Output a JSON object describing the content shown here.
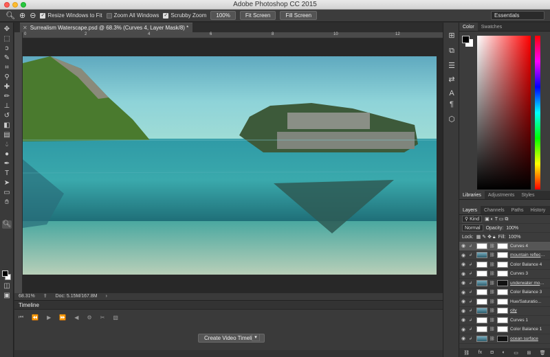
{
  "app": {
    "title": "Adobe Photoshop CC 2015"
  },
  "options": {
    "resize_windows": "Resize Windows to Fit",
    "zoom_all": "Zoom All Windows",
    "scrubby": "Scrubby Zoom",
    "pct100": "100%",
    "fit": "Fit Screen",
    "fill": "Fill Screen",
    "workspace": "Essentials"
  },
  "document": {
    "tab": "Surrealism Waterscape.psd @ 68.3% (Curves 4, Layer Mask/8) *",
    "zoom": "68.31%",
    "doc_size": "Doc: 5.15M/167.8M"
  },
  "rulers": {
    "top": [
      "0",
      "2",
      "4",
      "6",
      "8",
      "10",
      "12"
    ]
  },
  "timeline": {
    "title": "Timeline",
    "create_button": "Create Video Timeline"
  },
  "panels": {
    "color_tabs": [
      "Color",
      "Swatches"
    ],
    "lib_tabs": [
      "Libraries",
      "Adjustments",
      "Styles"
    ],
    "layer_tabs": [
      "Layers",
      "Channels",
      "Paths",
      "History"
    ],
    "kind": "Kind",
    "blend": "Normal",
    "opacity_label": "Opacity:",
    "opacity": "100%",
    "lock_label": "Lock:",
    "fill_label": "Fill:",
    "fill": "100%"
  },
  "layers": [
    {
      "name": "Curves 4",
      "thumb": "adj",
      "mask": "white",
      "active": true,
      "underline": false
    },
    {
      "name": "mountain reflecti...",
      "thumb": "img",
      "mask": "white",
      "active": false,
      "underline": true
    },
    {
      "name": "Color Balance 4",
      "thumb": "adj",
      "mask": "white",
      "active": false,
      "underline": false
    },
    {
      "name": "Curves 3",
      "thumb": "adj",
      "mask": "white",
      "active": false,
      "underline": false
    },
    {
      "name": "underwater mou...",
      "thumb": "img",
      "mask": "black",
      "active": false,
      "underline": true
    },
    {
      "name": "Color Balance 3",
      "thumb": "adj",
      "mask": "white",
      "active": false,
      "underline": false
    },
    {
      "name": "Hue/Saturatio...",
      "thumb": "adj",
      "mask": "white",
      "active": false,
      "underline": false
    },
    {
      "name": "city",
      "thumb": "img",
      "mask": "white",
      "active": false,
      "underline": true
    },
    {
      "name": "Curves 1",
      "thumb": "adj",
      "mask": "white",
      "active": false,
      "underline": false
    },
    {
      "name": "Color Balance 1",
      "thumb": "adj",
      "mask": "white",
      "active": false,
      "underline": false
    },
    {
      "name": "ocean surface",
      "thumb": "img",
      "mask": "black",
      "active": false,
      "underline": true
    }
  ],
  "colors": {
    "canvas_bg": "#282828",
    "panel": "#3c3c3c",
    "accent": "#565656"
  }
}
